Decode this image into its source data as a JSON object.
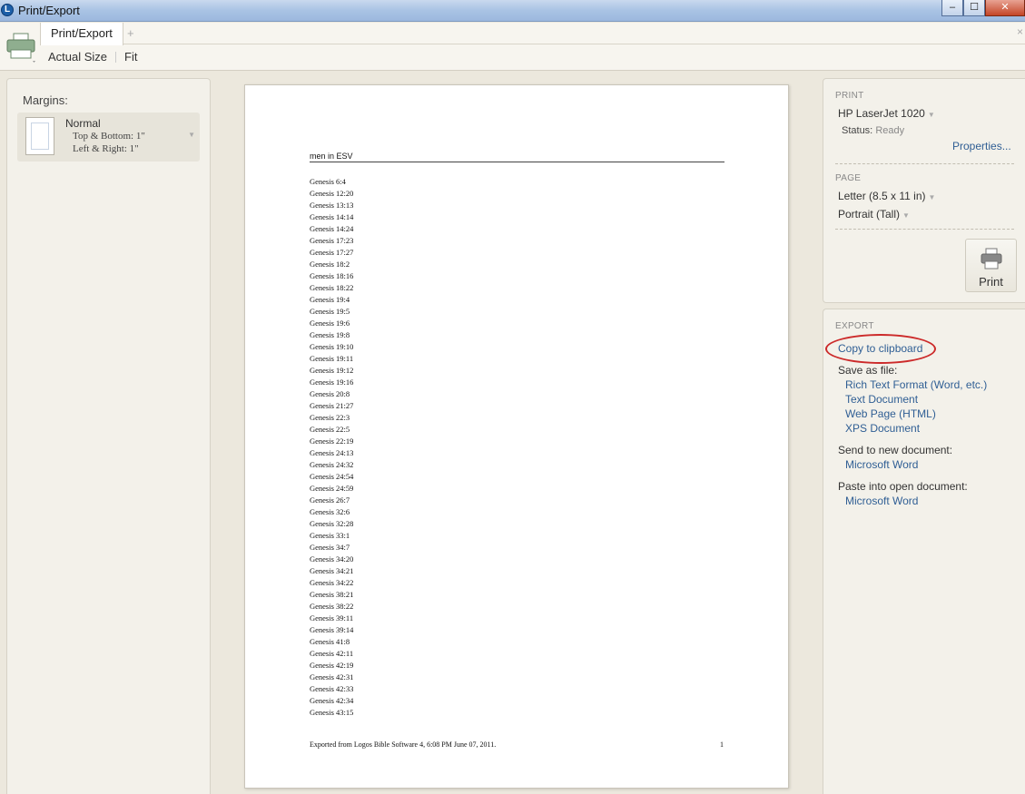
{
  "window": {
    "title": "Print/Export",
    "app_icon_glyph": "L",
    "controls": {
      "minimize": "–",
      "maximize": "☐",
      "close": "✕"
    }
  },
  "tabs": [
    {
      "label": "Print/Export",
      "active": true
    }
  ],
  "tab_add": "+",
  "tab_close": "×",
  "toolbar": {
    "actual_size": "Actual Size",
    "fit": "Fit"
  },
  "margins": {
    "label": "Margins:",
    "preset": "Normal",
    "top_bottom": "Top & Bottom:  1\"",
    "left_right": "Left & Right:   1\""
  },
  "document": {
    "title": "men in ESV",
    "verses": [
      "Genesis 6:4",
      "Genesis 12:20",
      "Genesis 13:13",
      "Genesis 14:14",
      "Genesis 14:24",
      "Genesis 17:23",
      "Genesis 17:27",
      "Genesis 18:2",
      "Genesis 18:16",
      "Genesis 18:22",
      "Genesis 19:4",
      "Genesis 19:5",
      "Genesis 19:6",
      "Genesis 19:8",
      "Genesis 19:10",
      "Genesis 19:11",
      "Genesis 19:12",
      "Genesis 19:16",
      "Genesis 20:8",
      "Genesis 21:27",
      "Genesis 22:3",
      "Genesis 22:5",
      "Genesis 22:19",
      "Genesis 24:13",
      "Genesis 24:32",
      "Genesis 24:54",
      "Genesis 24:59",
      "Genesis 26:7",
      "Genesis 32:6",
      "Genesis 32:28",
      "Genesis 33:1",
      "Genesis 34:7",
      "Genesis 34:20",
      "Genesis 34:21",
      "Genesis 34:22",
      "Genesis 38:21",
      "Genesis 38:22",
      "Genesis 39:11",
      "Genesis 39:14",
      "Genesis 41:8",
      "Genesis 42:11",
      "Genesis 42:19",
      "Genesis 42:31",
      "Genesis 42:33",
      "Genesis 42:34",
      "Genesis 43:15"
    ],
    "footer": "Exported from Logos Bible Software 4, 6:08 PM June 07, 2011.",
    "page_number": "1"
  },
  "print": {
    "section": "PRINT",
    "printer": "HP LaserJet 1020",
    "status_label": "Status:",
    "status_value": "Ready",
    "properties": "Properties...",
    "button": "Print"
  },
  "page_setup": {
    "section": "PAGE",
    "paper": "Letter (8.5 x 11 in)",
    "orientation": "Portrait (Tall)"
  },
  "export": {
    "section": "EXPORT",
    "copy": "Copy to clipboard",
    "save_label": "Save as file:",
    "save_options": [
      "Rich Text Format (Word, etc.)",
      "Text Document",
      "Web Page (HTML)",
      "XPS Document"
    ],
    "send_label": "Send to new document:",
    "send_option": "Microsoft Word",
    "paste_label": "Paste into open document:",
    "paste_option": "Microsoft Word"
  },
  "colors": {
    "link": "#2f5e94",
    "highlight": "#cc2a2a",
    "background": "#ece8dd"
  }
}
